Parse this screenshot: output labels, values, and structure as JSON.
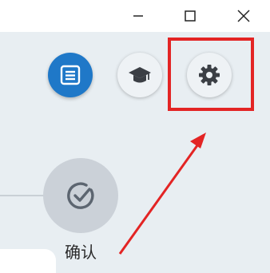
{
  "window": {
    "minimize_icon": "minimize-icon",
    "maximize_icon": "maximize-icon",
    "close_icon": "close-icon"
  },
  "toolbar": {
    "buttons": [
      {
        "name": "list-button",
        "icon": "list-icon",
        "color": "#1f78c8"
      },
      {
        "name": "course-button",
        "icon": "graduation-cap-icon",
        "color": "#eef2f5"
      },
      {
        "name": "settings-button",
        "icon": "gear-icon",
        "color": "#eef2f5"
      }
    ]
  },
  "annotation": {
    "highlight_color": "#e32424",
    "target": "settings-button"
  },
  "confirm": {
    "label": "确认",
    "icon": "check-icon"
  }
}
